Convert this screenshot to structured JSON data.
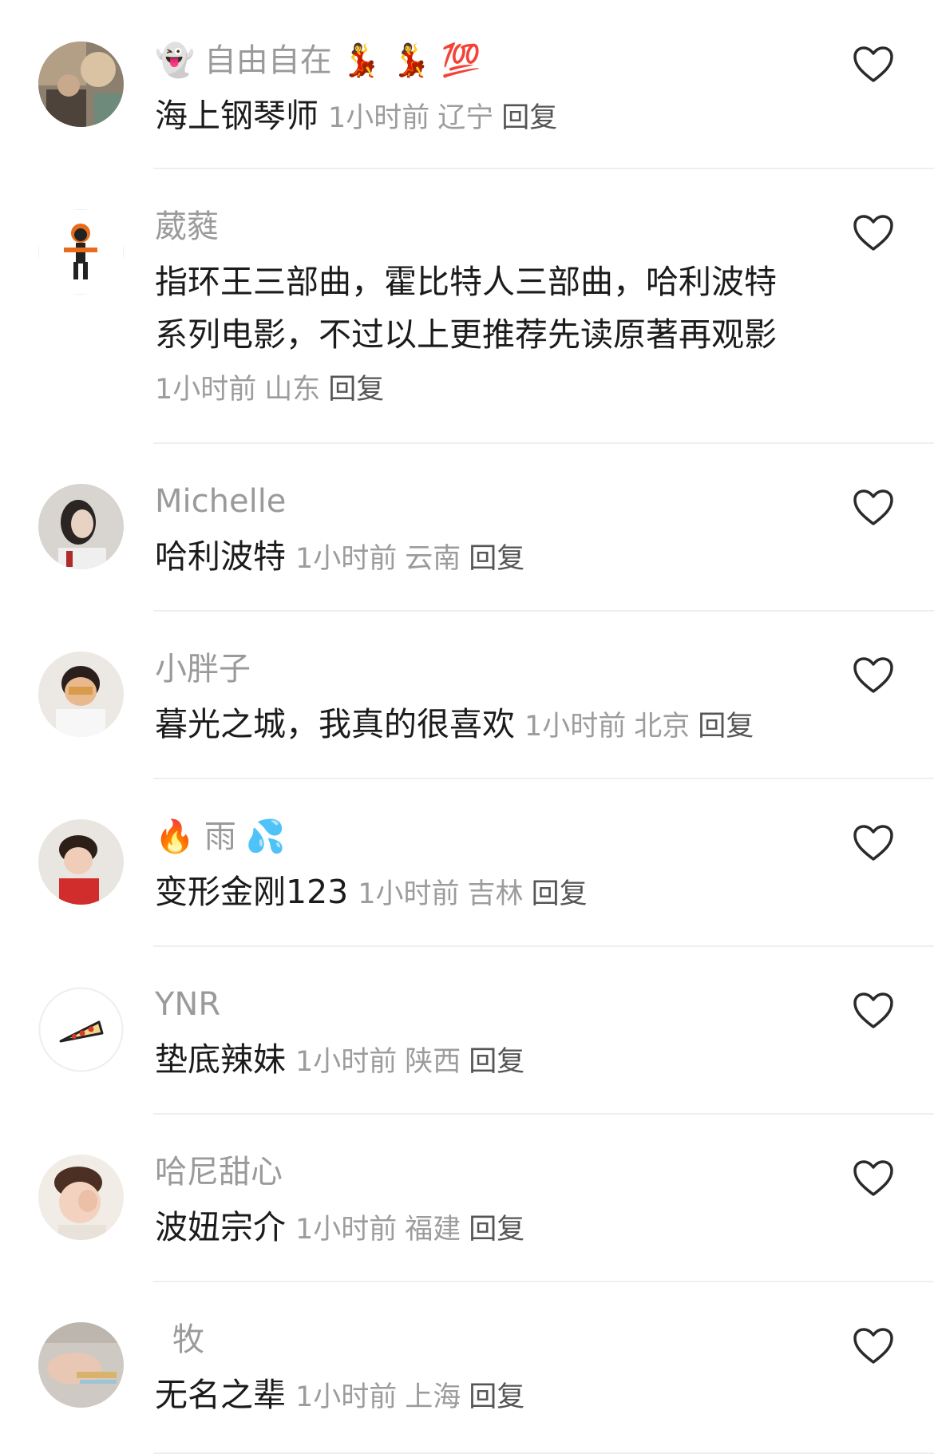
{
  "comments": [
    {
      "prefix_emoji": "👻",
      "nickname": "自由自在",
      "suffix_emoji": "💃 💃 💯",
      "content": "海上钢琴师",
      "time": "1小时前",
      "region": "辽宁",
      "reply_label": "回复",
      "avatar_icon": "photo-avatar"
    },
    {
      "prefix_emoji": "",
      "nickname": "葳蕤",
      "suffix_emoji": "",
      "content": "指环王三部曲，霍比特人三部曲，哈利波特系列电影，不过以上更推荐先读原著再观影",
      "time": "1小时前",
      "region": "山东",
      "reply_label": "回复",
      "avatar_icon": "skeleton-avatar"
    },
    {
      "prefix_emoji": "",
      "nickname": "Michelle",
      "suffix_emoji": "",
      "content": "哈利波特",
      "time": "1小时前",
      "region": "云南",
      "reply_label": "回复",
      "avatar_icon": "photo-avatar"
    },
    {
      "prefix_emoji": "",
      "nickname": "小胖子",
      "suffix_emoji": "",
      "content": "暮光之城，我真的很喜欢",
      "time": "1小时前",
      "region": "北京",
      "reply_label": "回复",
      "avatar_icon": "photo-avatar"
    },
    {
      "prefix_emoji": "🔥",
      "nickname": "雨",
      "suffix_emoji": "💦",
      "content": "变形金刚123",
      "time": "1小时前",
      "region": "吉林",
      "reply_label": "回复",
      "avatar_icon": "photo-avatar"
    },
    {
      "prefix_emoji": "",
      "nickname": "YNR",
      "suffix_emoji": "",
      "content": "垫底辣妹",
      "time": "1小时前",
      "region": "陕西",
      "reply_label": "回复",
      "avatar_icon": "pizza-avatar"
    },
    {
      "prefix_emoji": "",
      "nickname": "哈尼甜心",
      "suffix_emoji": "",
      "content": "波妞宗介",
      "time": "1小时前",
      "region": "福建",
      "reply_label": "回复",
      "avatar_icon": "photo-avatar"
    },
    {
      "prefix_emoji": "",
      "nickname": "牧",
      "suffix_emoji": "",
      "content": "无名之辈",
      "time": "1小时前",
      "region": "上海",
      "reply_label": "回复",
      "avatar_icon": "photo-avatar"
    }
  ],
  "like_icon": "heart-outline-icon",
  "colors": {
    "nickname": "#9a9a9a",
    "content": "#1b1b1b",
    "meta": "#9c9c9c",
    "divider": "#efefef"
  }
}
